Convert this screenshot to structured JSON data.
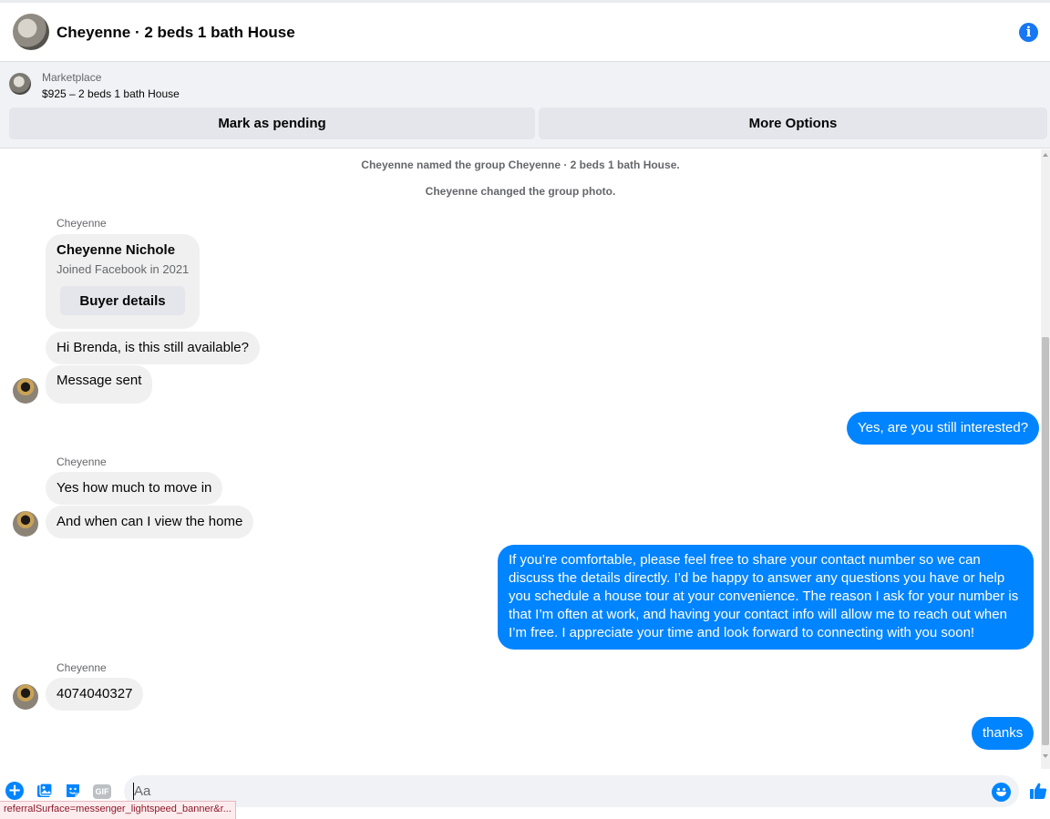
{
  "header": {
    "title": "Cheyenne · 2 beds 1 bath House",
    "info_icon": "info-icon"
  },
  "marketplace": {
    "label": "Marketplace",
    "listing": "$925 – 2 beds 1 bath House",
    "mark_pending_label": "Mark as pending",
    "more_options_label": "More Options"
  },
  "chat": {
    "system_messages": [
      "Cheyenne named the group Cheyenne · 2 beds 1 bath House.",
      "Cheyenne changed the group photo."
    ],
    "sender_name": "Cheyenne",
    "profile_card": {
      "name": "Cheyenne Nichole",
      "joined": "Joined Facebook in 2021",
      "button_label": "Buyer details"
    },
    "messages": [
      {
        "from": "them",
        "text": "Hi Brenda, is this still available?"
      },
      {
        "from": "them",
        "text": "Message sent"
      },
      {
        "from": "me",
        "text": "Yes, are you still interested?"
      },
      {
        "from": "them",
        "text": "Yes how much to move in"
      },
      {
        "from": "them",
        "text": "And when can I view the home"
      },
      {
        "from": "me",
        "text": "If you’re comfortable, please feel free to share your contact number so we can discuss the details directly. I’d be happy to answer any questions you have or help you schedule a house tour at your convenience. The reason I ask for your number is that I’m often at work, and having your contact info will allow me to reach out when I’m free. I appreciate your time and look forward to connecting with you soon!"
      },
      {
        "from": "them",
        "text": "4074040327"
      },
      {
        "from": "me",
        "text": "thanks"
      }
    ]
  },
  "composer": {
    "placeholder": "Aa",
    "gif_label": "GIF"
  },
  "status_bar": {
    "url": "referralSurface=messenger_lightspeed_banner&r..."
  },
  "colors": {
    "accent": "#0084ff",
    "incoming_bubble": "#f0f0f0",
    "button_bg": "#e4e6eb"
  }
}
